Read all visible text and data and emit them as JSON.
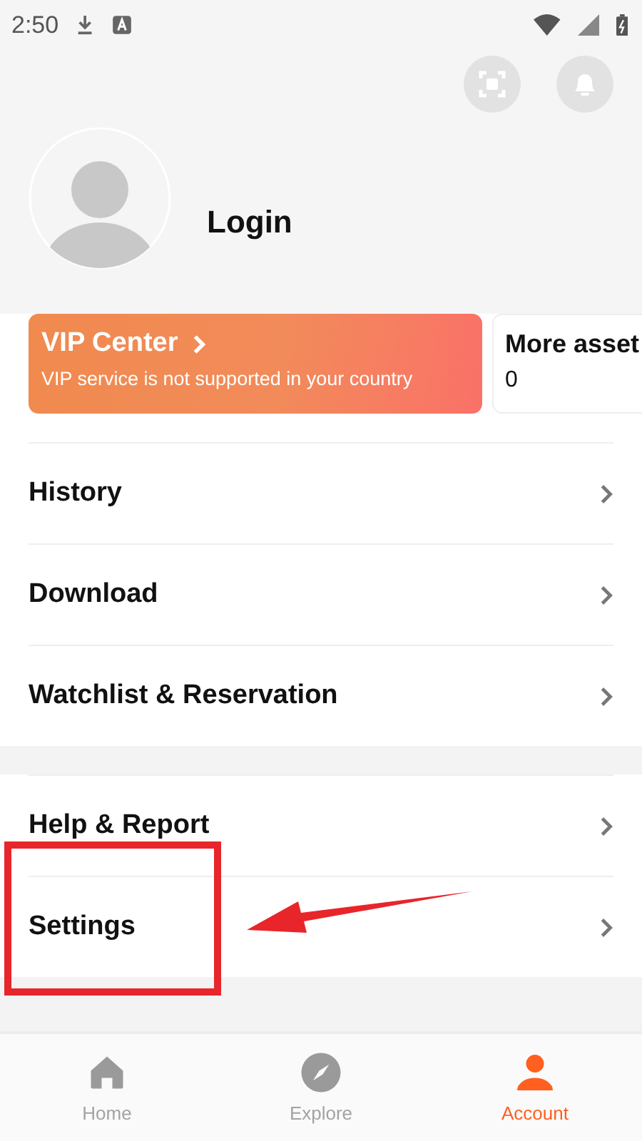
{
  "status_bar": {
    "time": "2:50"
  },
  "profile": {
    "login_label": "Login"
  },
  "cards": [
    {
      "kind": "vip",
      "title": "VIP Center",
      "subtitle": "VIP service is not supported in your country"
    },
    {
      "kind": "assets",
      "title": "More asset",
      "value": "0"
    }
  ],
  "menu_sections": [
    {
      "items": [
        {
          "label": "History",
          "highlighted": false
        },
        {
          "label": "Download",
          "highlighted": false
        },
        {
          "label": "Watchlist & Reservation",
          "highlighted": false
        }
      ]
    },
    {
      "items": [
        {
          "label": "Help & Report",
          "highlighted": false
        },
        {
          "label": "Settings",
          "highlighted": true
        }
      ]
    }
  ],
  "bottom_nav": [
    {
      "kind": "home",
      "label": "Home",
      "selected": false
    },
    {
      "kind": "explore",
      "label": "Explore",
      "selected": false
    },
    {
      "kind": "account",
      "label": "Account",
      "selected": true
    }
  ]
}
